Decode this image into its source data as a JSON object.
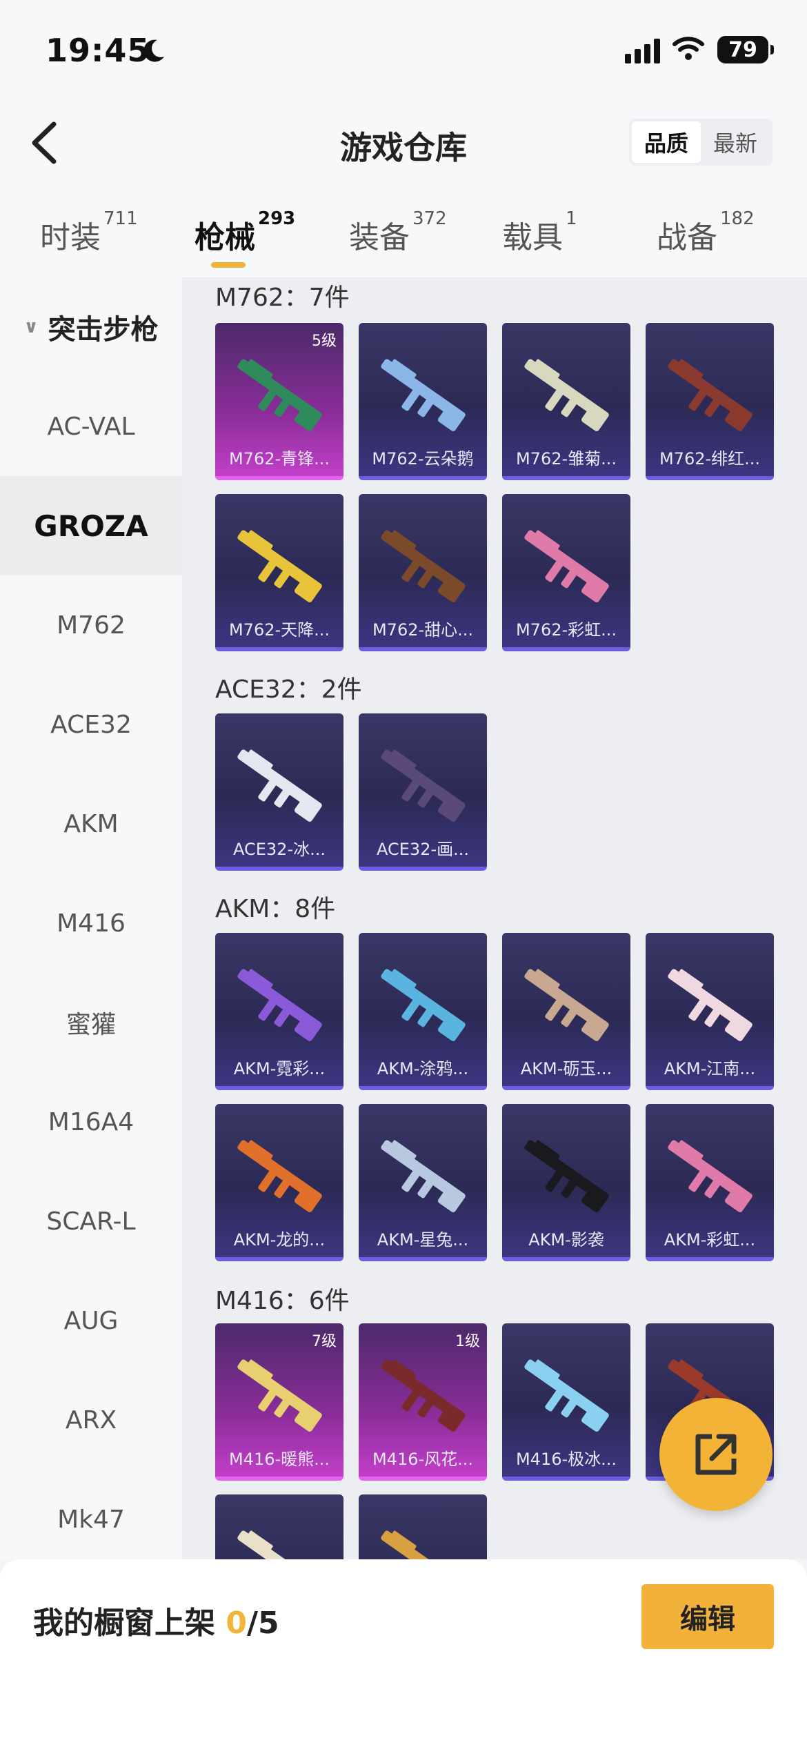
{
  "status": {
    "time": "19:45",
    "battery": "79"
  },
  "header": {
    "title": "游戏仓库",
    "sort_options": [
      "品质",
      "最新"
    ]
  },
  "tabs": [
    {
      "label": "时装",
      "count": "711"
    },
    {
      "label": "枪械",
      "count": "293"
    },
    {
      "label": "装备",
      "count": "372"
    },
    {
      "label": "载具",
      "count": "1"
    },
    {
      "label": "战备",
      "count": "182"
    }
  ],
  "sidebar": {
    "group": "突击步枪",
    "items": [
      "AC-VAL",
      "GROZA",
      "M762",
      "ACE32",
      "AKM",
      "M416",
      "蜜獾",
      "M16A4",
      "SCAR-L",
      "AUG",
      "ARX",
      "Mk47"
    ]
  },
  "sections": [
    {
      "title": "M762：7件",
      "items": [
        {
          "label": "M762-青锋...",
          "level": "5级",
          "tier": "gold",
          "color": "#2f8a5c"
        },
        {
          "label": "M762-云朵鹅",
          "level": "",
          "tier": "purple",
          "color": "#8ab6e8"
        },
        {
          "label": "M762-雏菊...",
          "level": "",
          "tier": "purple",
          "color": "#d8d8c0"
        },
        {
          "label": "M762-绯红...",
          "level": "",
          "tier": "purple",
          "color": "#8a3a2e"
        },
        {
          "label": "M762-天降...",
          "level": "",
          "tier": "purple",
          "color": "#e8c43a"
        },
        {
          "label": "M762-甜心...",
          "level": "",
          "tier": "purple",
          "color": "#7a4a2a"
        },
        {
          "label": "M762-彩虹...",
          "level": "",
          "tier": "purple",
          "color": "#e07aa8"
        }
      ]
    },
    {
      "title": "ACE32：2件",
      "items": [
        {
          "label": "ACE32-冰...",
          "level": "",
          "tier": "purple",
          "color": "#e4e6f0"
        },
        {
          "label": "ACE32-画...",
          "level": "",
          "tier": "purple",
          "color": "#5a4a7a"
        }
      ]
    },
    {
      "title": "AKM：8件",
      "items": [
        {
          "label": "AKM-霓彩...",
          "level": "",
          "tier": "purple",
          "color": "#8a5ad8"
        },
        {
          "label": "AKM-涂鸦...",
          "level": "",
          "tier": "purple",
          "color": "#5ab4e0"
        },
        {
          "label": "AKM-砺玉...",
          "level": "",
          "tier": "purple",
          "color": "#c8a890"
        },
        {
          "label": "AKM-江南...",
          "level": "",
          "tier": "purple",
          "color": "#f0d8e0"
        },
        {
          "label": "AKM-龙的...",
          "level": "",
          "tier": "purple",
          "color": "#e0702a"
        },
        {
          "label": "AKM-星兔...",
          "level": "",
          "tier": "purple",
          "color": "#b8c8e0"
        },
        {
          "label": "AKM-影袭",
          "level": "",
          "tier": "purple",
          "color": "#1a1a1e"
        },
        {
          "label": "AKM-彩虹...",
          "level": "",
          "tier": "purple",
          "color": "#e07aa8"
        }
      ]
    },
    {
      "title": "M416：6件",
      "items": [
        {
          "label": "M416-暖熊...",
          "level": "7级",
          "tier": "gold",
          "color": "#e8d070"
        },
        {
          "label": "M416-风花...",
          "level": "1级",
          "tier": "gold",
          "color": "#7a2a2a"
        },
        {
          "label": "M416-极冰...",
          "level": "",
          "tier": "purple",
          "color": "#8ad0f0"
        },
        {
          "label": "",
          "level": "",
          "tier": "purple",
          "color": "#9a3a2a"
        },
        {
          "label": "",
          "level": "",
          "tier": "purple",
          "color": "#e8e0c8"
        },
        {
          "label": "",
          "level": "",
          "tier": "purple",
          "color": "#d8a040"
        }
      ]
    }
  ],
  "bottom": {
    "showcase_label": "我的橱窗上架 ",
    "showcase_count": "0",
    "showcase_total": "/5",
    "edit_label": "编辑"
  }
}
